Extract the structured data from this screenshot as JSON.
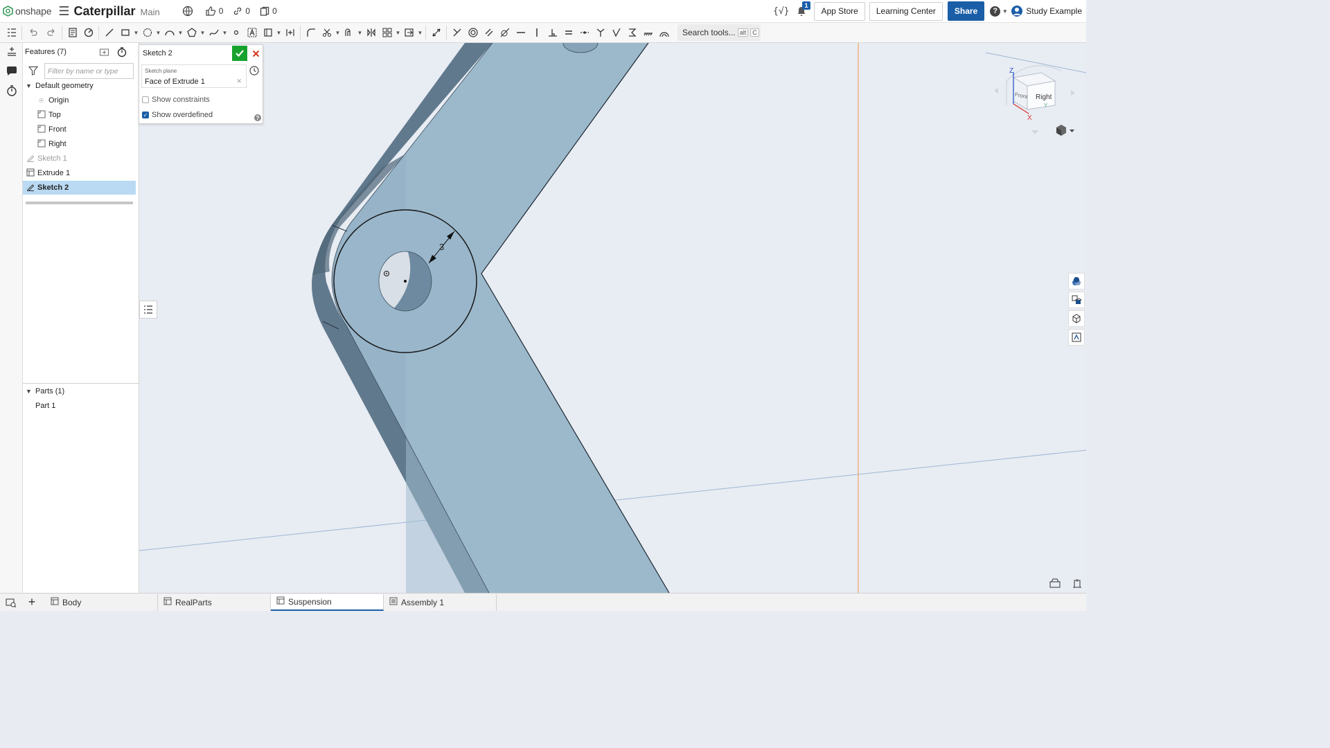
{
  "app": {
    "logo_text": "onshape",
    "doc_title": "Caterpillar",
    "branch": "Main"
  },
  "header": {
    "likes_count": "0",
    "links_count": "0",
    "copies_count": "0",
    "notifications_count": "1",
    "app_store_label": "App Store",
    "learning_center_label": "Learning Center",
    "share_label": "Share",
    "help_label": "?",
    "user_name": "Study Example"
  },
  "toolbar": {
    "search_label": "Search tools...",
    "search_shortcut_alt": "alt",
    "search_shortcut_key": "C"
  },
  "features_panel": {
    "title": "Features (7)",
    "filter_placeholder": "Filter by name or type",
    "default_geometry_label": "Default geometry",
    "items": [
      {
        "label": "Origin"
      },
      {
        "label": "Top"
      },
      {
        "label": "Front"
      },
      {
        "label": "Right"
      },
      {
        "label": "Sketch 1"
      },
      {
        "label": "Extrude 1"
      },
      {
        "label": "Sketch 2"
      }
    ],
    "parts_label": "Parts (1)",
    "parts": [
      {
        "label": "Part 1"
      }
    ]
  },
  "sketch_dialog": {
    "title": "Sketch 2",
    "plane_label": "Sketch plane",
    "plane_value": "Face of Extrude 1",
    "show_constraints_label": "Show constraints",
    "show_constraints": false,
    "show_overdefined_label": "Show overdefined",
    "show_overdefined": true,
    "help_label": "?"
  },
  "viewport": {
    "dimension_value": "3",
    "view_cube_top": "Z",
    "view_cube_x": "X",
    "view_cube_y": "Y",
    "view_cube_front": "Front",
    "view_cube_right": "Right"
  },
  "tabs": [
    {
      "label": "Body"
    },
    {
      "label": "RealParts"
    },
    {
      "label": "Suspension"
    },
    {
      "label": "Assembly 1"
    }
  ],
  "colors": {
    "accent": "#1a5ea8",
    "confirm": "#17a22d",
    "cancel": "#d63b1f",
    "part_face": "#96b3c8",
    "part_side": "#5f7e95",
    "selected_row": "#b9daf2"
  }
}
